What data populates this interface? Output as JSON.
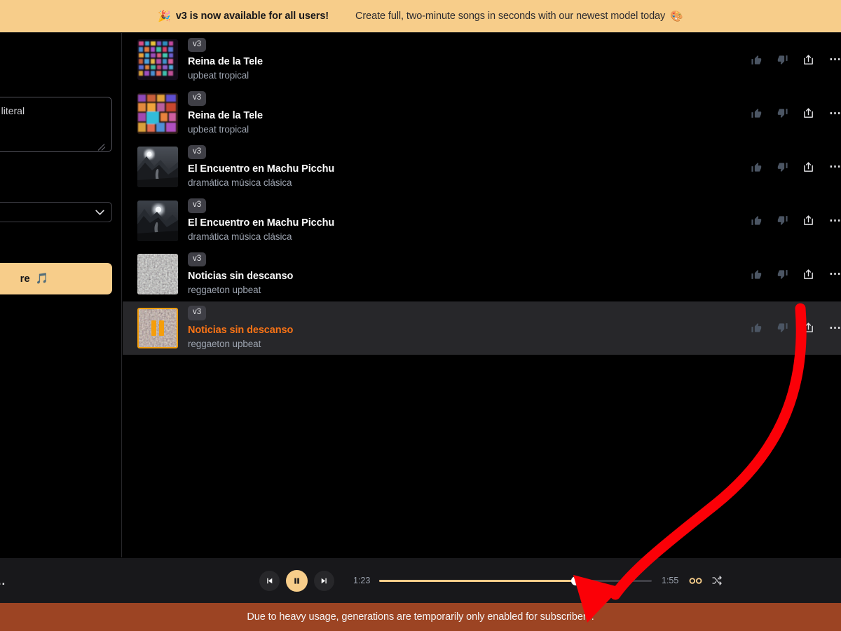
{
  "promo_banner": {
    "party_icon": "party-popper-emoji",
    "headline": "v3 is now available for all users!",
    "subtext": "Create full, two-minute songs in seconds with our newest model today",
    "trailing_icon": "artist-palette-emoji",
    "background": "#f7cd8a",
    "text_color": "#18181b"
  },
  "sidebar": {
    "prompt_textarea": {
      "value": "about a literal",
      "placeholder": "about a literal"
    },
    "style_select": {
      "value": "",
      "chevron": "chevron-down-icon"
    },
    "create_button": {
      "label": "re",
      "icon": "music-note-emoji",
      "background": "#f7cd8a"
    },
    "bottom_more": "..."
  },
  "song_list": {
    "rows": [
      {
        "version": "v3",
        "title": "Reina de la Tele",
        "style": "upbeat tropical",
        "thumb": "tv-mosaic-colorful",
        "active": false,
        "actions": [
          "thumbs-up-icon",
          "thumbs-down-icon",
          "share-icon",
          "more-options-icon"
        ]
      },
      {
        "version": "v3",
        "title": "Reina de la Tele",
        "style": "upbeat tropical",
        "thumb": "tv-mosaic-warm",
        "active": false,
        "actions": [
          "thumbs-up-icon",
          "thumbs-down-icon",
          "share-icon",
          "more-options-icon"
        ]
      },
      {
        "version": "v3",
        "title": "El Encuentro en Machu Picchu",
        "style": "dramática música clásica",
        "thumb": "moonlit-mountain-grey",
        "active": false,
        "actions": [
          "thumbs-up-icon",
          "thumbs-down-icon",
          "share-icon",
          "more-options-icon"
        ]
      },
      {
        "version": "v3",
        "title": "El Encuentro en Machu Picchu",
        "style": "dramática música clásica",
        "thumb": "moonlit-mountain-dark",
        "active": false,
        "actions": [
          "thumbs-up-icon",
          "thumbs-down-icon",
          "share-icon",
          "more-options-icon"
        ]
      },
      {
        "version": "v3",
        "title": "Noticias sin descanso",
        "style": "reggaeton upbeat",
        "thumb": "grey-rubble-texture",
        "active": false,
        "actions": [
          "thumbs-up-icon",
          "thumbs-down-icon",
          "share-icon",
          "more-options-icon"
        ]
      },
      {
        "version": "v3",
        "title": "Noticias sin descanso",
        "style": "reggaeton upbeat",
        "thumb": "rubble-texture-orange",
        "active": true,
        "playing_overlay": "pause-icon",
        "actions": [
          "thumbs-up-icon",
          "thumbs-down-icon",
          "share-icon",
          "more-options-icon"
        ]
      }
    ],
    "active_title_color": "#f97316",
    "active_row_background": "#27272a"
  },
  "player": {
    "left_more": "...",
    "prev_icon": "skip-previous-icon",
    "play_pause_icon": "pause-icon",
    "next_icon": "skip-next-icon",
    "current_time": "1:23",
    "total_time": "1:55",
    "progress_percent": 72,
    "loop_icon": "infinity-loop-icon",
    "shuffle_icon": "shuffle-icon",
    "accent_color": "#f7cd8a"
  },
  "notice": {
    "message": "Due to heavy usage, generations are temporarily only enabled for subscribers.",
    "background": "#9c4423",
    "text_color": "#f4f4f5"
  },
  "annotation": {
    "arrow_color": "#fb0007",
    "kind": "curved-pointer-arrow"
  }
}
